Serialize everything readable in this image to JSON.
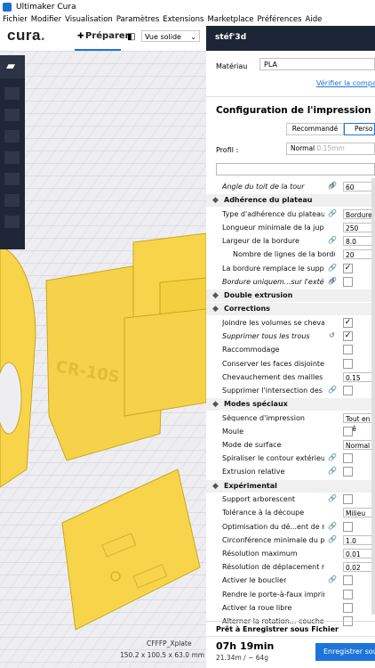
{
  "window": {
    "title": "Ultimaker Cura"
  },
  "menu": [
    "Fichier",
    "Modifier",
    "Visualisation",
    "Paramètres",
    "Extensions",
    "Marketplace",
    "Préférences",
    "Aide"
  ],
  "header": {
    "logo": "cura",
    "tab": "Préparer",
    "view_select": "Vue solide"
  },
  "panel": {
    "machine": "stéf'3d",
    "material_label": "Matériau",
    "material_value": "PLA",
    "compat_link": "Vérifier la compa",
    "config_title": "Configuration de l'impression",
    "mode_recommended": "Recommandé",
    "mode_custom": "Perso",
    "profile_label": "Profil :",
    "profile_value": "Normal",
    "profile_sub": "0.15mm"
  },
  "settings": [
    {
      "type": "row",
      "label": "Angle du toit de la tour",
      "italic": true,
      "value": "60",
      "link": true,
      "reset": true
    },
    {
      "type": "section",
      "label": "Adhérence du plateau",
      "icon": "adhesion-icon"
    },
    {
      "type": "row",
      "label": "Type d'adhérence du plateau",
      "value": "Bordure",
      "link": true
    },
    {
      "type": "row",
      "label": "Longueur minimale de la jupe/bordure",
      "value": "250"
    },
    {
      "type": "row",
      "label": "Largeur de la bordure",
      "value": "8.0",
      "link": true
    },
    {
      "type": "row",
      "label": "Nombre de lignes de la bordure",
      "value": "20",
      "indent": true
    },
    {
      "type": "row",
      "label": "La bordure remplace le support",
      "check": "✓",
      "link": true
    },
    {
      "type": "row",
      "label": "Bordure uniquem...sur l'extérieur",
      "italic": true,
      "check": "",
      "link": true,
      "reset": true
    },
    {
      "type": "section",
      "label": "Double extrusion",
      "icon": "dual-extrusion-icon"
    },
    {
      "type": "section",
      "label": "Corrections",
      "icon": "corrections-icon"
    },
    {
      "type": "row",
      "label": "Joindre les volumes se chevauchant",
      "check": "✓"
    },
    {
      "type": "row",
      "label": "Supprimer tous les trous",
      "italic": true,
      "check": "✓",
      "reset": true
    },
    {
      "type": "row",
      "label": "Raccommodage",
      "check": ""
    },
    {
      "type": "row",
      "label": "Conserver les faces disjointes",
      "check": ""
    },
    {
      "type": "row",
      "label": "Chevauchement des mailles fusionnées",
      "value": "0.15"
    },
    {
      "type": "row",
      "label": "Supprimer l'intersection des mailles",
      "check": "",
      "link": true
    },
    {
      "type": "section",
      "label": "Modes spéciaux",
      "icon": "special-modes-icon"
    },
    {
      "type": "row",
      "label": "Séquence d'impression",
      "value": "Tout en mê"
    },
    {
      "type": "row",
      "label": "Moule",
      "check": ""
    },
    {
      "type": "row",
      "label": "Mode de surface",
      "value": "Normal"
    },
    {
      "type": "row",
      "label": "Spiraliser le contour extérieur",
      "check": "",
      "link": true
    },
    {
      "type": "row",
      "label": "Extrusion relative",
      "check": "",
      "link": true
    },
    {
      "type": "section",
      "label": "Expérimental",
      "icon": "experimental-icon"
    },
    {
      "type": "row",
      "label": "Support arborescent",
      "check": "",
      "link": true
    },
    {
      "type": "row",
      "label": "Tolérance à la découpe",
      "value": "Milieu"
    },
    {
      "type": "row",
      "label": "Optimisation du dé...ent de remplissage",
      "check": "",
      "link": true
    },
    {
      "type": "row",
      "label": "Circonférence minimale du polygone",
      "value": "1.0",
      "link": true
    },
    {
      "type": "row",
      "label": "Résolution maximum",
      "value": "0.01"
    },
    {
      "type": "row",
      "label": "Résolution de déplacement maximum",
      "value": "0.02"
    },
    {
      "type": "row",
      "label": "Activer le bouclier",
      "check": "",
      "link": true
    },
    {
      "type": "row",
      "label": "Rendre le porte-à-faux imprimable",
      "check": ""
    },
    {
      "type": "row",
      "label": "Activer la roue libre",
      "check": ""
    },
    {
      "type": "row",
      "label": "Alterner la rotation... couches extérieures",
      "check": ""
    }
  ],
  "footer": {
    "ready": "Prêt à Enregistrer sous Fichier",
    "time": "07h 19min",
    "material": "21.34m / ~ 64g",
    "save_button": "Enregistrer sous F",
    "object_name": "CFFFP_Xplate",
    "object_dims": "150.2 x 100.5 x 63.0 mm"
  },
  "model_text": "CR-10S"
}
